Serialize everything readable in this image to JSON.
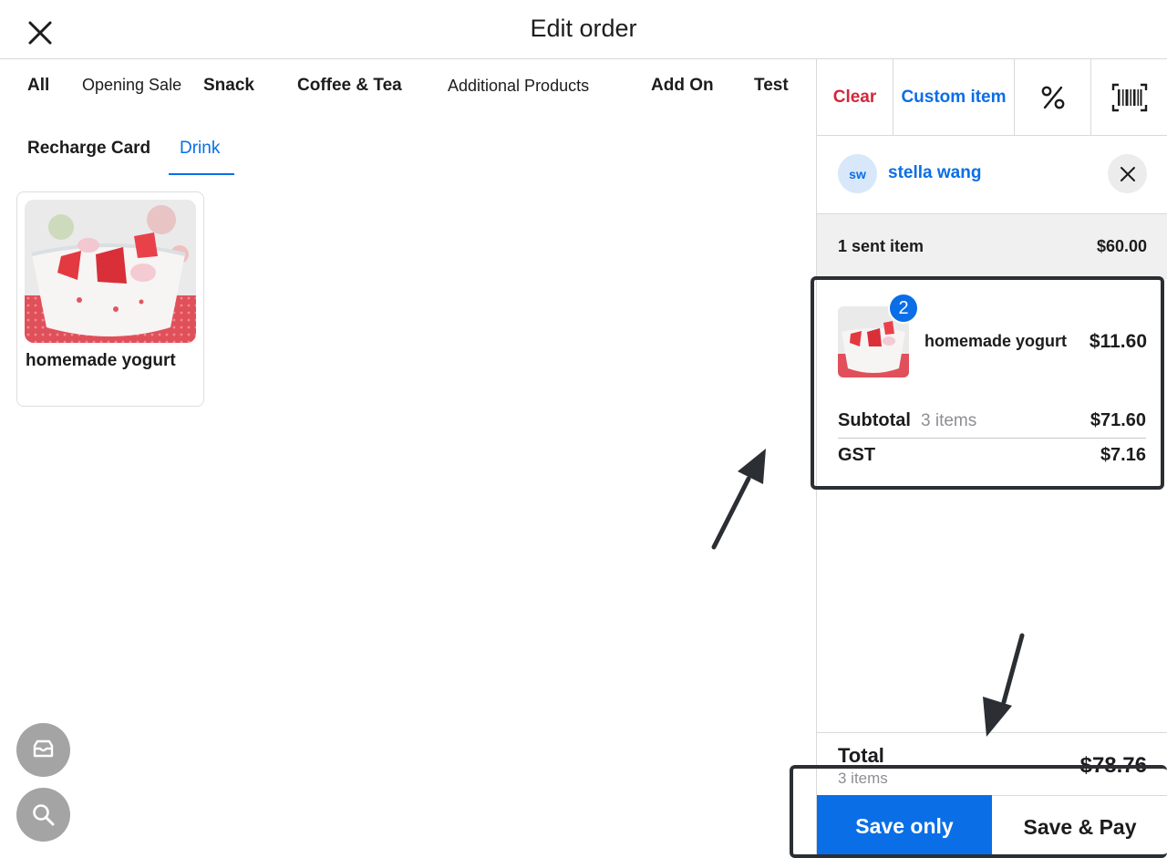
{
  "header": {
    "title": "Edit order"
  },
  "categories": {
    "row1": [
      "All",
      "Opening Sale",
      "Snack",
      "Coffee & Tea",
      "Additional Products",
      "Add On",
      "Test"
    ],
    "row2": [
      "Recharge Card",
      "Drink"
    ],
    "active": "Drink"
  },
  "products": [
    {
      "name": "homemade yogurt"
    }
  ],
  "icons": {
    "close": "close-icon",
    "tray": "tray-icon",
    "search": "search-icon",
    "percent": "percent-icon",
    "barcode": "barcode-icon"
  },
  "panel": {
    "toolbar": {
      "clear": "Clear",
      "custom_item": "Custom item"
    },
    "customer": {
      "initials": "sw",
      "name": "stella wang"
    },
    "sent": {
      "label": "1 sent item",
      "amount": "$60.00"
    },
    "line_item": {
      "qty": "2",
      "name": "homemade yogurt",
      "price": "$11.60"
    },
    "subtotal": {
      "label": "Subtotal",
      "count": "3 items",
      "amount": "$71.60"
    },
    "gst": {
      "label": "GST",
      "amount": "$7.16"
    },
    "total": {
      "label": "Total",
      "count": "3 items",
      "amount": "$78.76"
    },
    "save_only": "Save only",
    "save_pay": "Save & Pay"
  },
  "colors": {
    "accent": "#0a6ee6",
    "danger": "#d5263a",
    "annotation": "#2b2f33"
  }
}
